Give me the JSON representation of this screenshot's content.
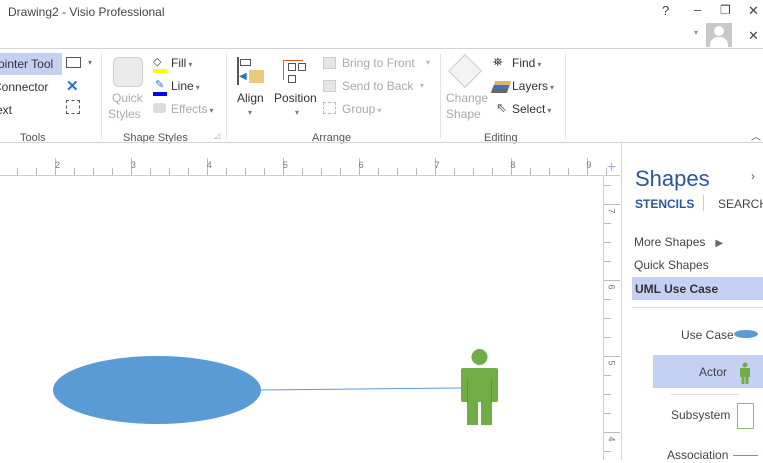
{
  "window": {
    "title": "Drawing2 - Visio Professional",
    "help": "?",
    "minimize": "–",
    "restore": "❐",
    "close": "✕",
    "close_doc": "✕"
  },
  "ribbon": {
    "tools": {
      "pointer": "Pointer Tool",
      "connector": "Connector",
      "text": "Text",
      "label": "Tools"
    },
    "shape_styles": {
      "quick_styles_1": "Quick",
      "quick_styles_2": "Styles",
      "fill": "Fill",
      "line": "Line",
      "effects": "Effects",
      "label": "Shape Styles"
    },
    "arrange": {
      "align": "Align",
      "position": "Position",
      "bring_front": "Bring to Front",
      "send_back": "Send to Back",
      "group": "Group",
      "label": "Arrange"
    },
    "editing": {
      "change_1": "Change",
      "change_2": "Shape",
      "find": "Find",
      "layers": "Layers",
      "select": "Select",
      "label": "Editing"
    },
    "colors": {
      "fill": "#ffff00",
      "line": "#0000ff"
    }
  },
  "ruler": {
    "h": [
      "2",
      "3",
      "4",
      "5",
      "6",
      "7",
      "8",
      "9"
    ],
    "v": [
      "7",
      "6",
      "5",
      "4"
    ]
  },
  "shapes_pane": {
    "title": "Shapes",
    "tabs": [
      "STENCILS",
      "SEARCH"
    ],
    "nav": [
      "More Shapes",
      "Quick Shapes",
      "UML Use Case"
    ],
    "stencil": [
      "Use Case",
      "Actor",
      "Subsystem",
      "Association"
    ]
  },
  "colors": {
    "accent": "#2b579a",
    "ellipse": "#5b9bd5",
    "actor": "#70ad47",
    "highlight": "#c5d1f2"
  }
}
